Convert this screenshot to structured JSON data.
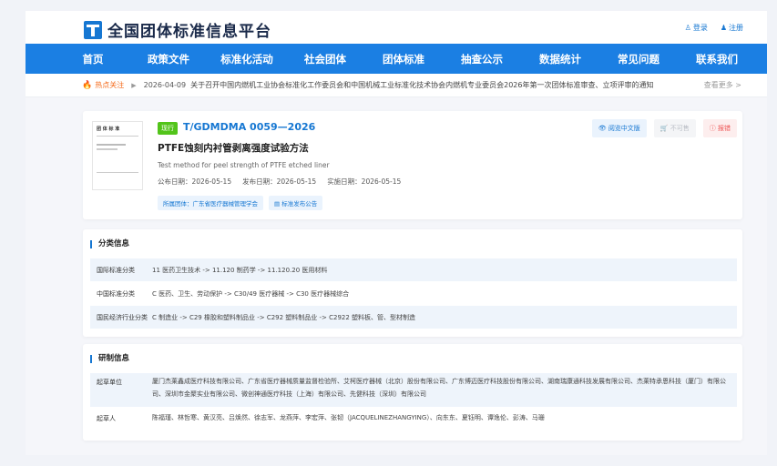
{
  "site": {
    "title": "全国团体标准信息平台",
    "login": "登录",
    "register": "注册"
  },
  "nav": [
    "首页",
    "政策文件",
    "标准化活动",
    "社会团体",
    "团体标准",
    "抽查公示",
    "数据统计",
    "常见问题",
    "联系我们"
  ],
  "news": {
    "label": "热点关注",
    "date": "2026-04-09",
    "title": "关于召开中国内燃机工业协会标准化工作委员会和中国机械工业标准化技术协会内燃机专业委员会2026年第一次团体标准审查、立项评审的通知",
    "more": "查看更多 >"
  },
  "standard": {
    "thumb_title": "团 体 标 准",
    "status": "现行",
    "code": "T/GDMDMA 0059—2026",
    "name_cn": "PTFE蚀刻内衬管剥离强度试验方法",
    "name_en": "Test method for peel strength of PTFE etched liner",
    "publish_date": "公布日期：2026-05-15",
    "issue_date": "发布日期：2026-05-15",
    "impl_date": "实施日期：2026-05-15",
    "group_chip": "所属团体：广东省医疗器械管理学会",
    "notice_chip": "标准发布公告",
    "btn_read": "阅览中文版",
    "btn_buy": "不可售",
    "btn_error": "报错"
  },
  "classification": {
    "title": "分类信息",
    "rows": [
      {
        "key": "国际标准分类",
        "value": "11 医药卫生技术 -> 11.120 制药学 -> 11.120.20 医用材料"
      },
      {
        "key": "中国标准分类",
        "value": "C 医药、卫生、劳动保护 -> C30/49 医疗器械 -> C30 医疗器械综合"
      },
      {
        "key": "国民经济行业分类",
        "value": "C 制造业 -> C29 橡胶和塑料制品业 -> C292 塑料制品业 -> C2922 塑料板、管、型材制造"
      }
    ]
  },
  "development": {
    "title": "研制信息",
    "rows": [
      {
        "key": "起草单位",
        "value": "厦门杰莱鑫成医疗科技有限公司、广东省医疗器械质量监督检验所、艾柯医疗器械（北京）股份有限公司、广东博迈医疗科技股份有限公司、湖南瑞康通科技发展有限公司、杰莱特承恩科技（厦门）有限公司、深圳市金聚实业有限公司、微创神通医疗科技（上海）有限公司、先健科技（深圳）有限公司"
      },
      {
        "key": "起草人",
        "value": "陈福瑾、林哲寒、黄汉亮、吕焕然、徐志军、龙燕萍、李宏萍、张韧（JACQUELINEZHANGYING）、向东东、夏钰明、谭逸伦、彭涛、马珊"
      }
    ]
  }
}
